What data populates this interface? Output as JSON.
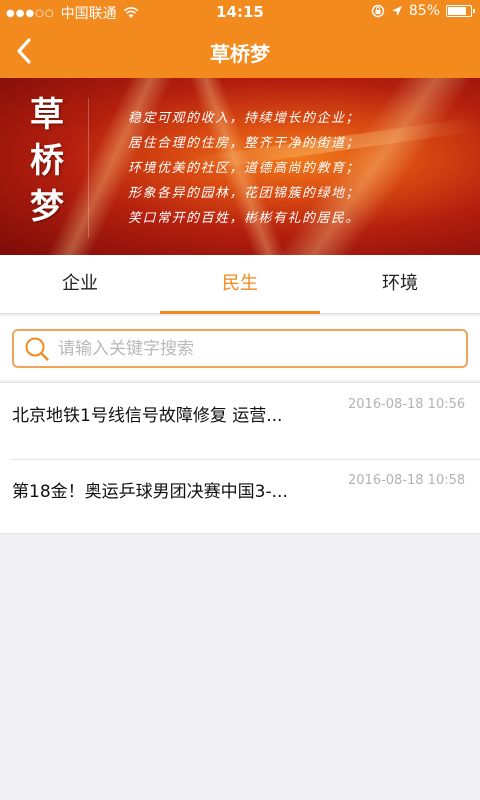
{
  "status_bar": {
    "signal": "●●●○○",
    "carrier": "中国联通",
    "time": "14:15",
    "battery_percent": "85%",
    "battery_level": 0.85
  },
  "nav": {
    "title": "草桥梦",
    "back_icon": "chevron-left-icon"
  },
  "banner": {
    "title_chars": [
      "草",
      "桥",
      "梦"
    ],
    "poem_lines": [
      "稳定可观的收入，持续增长的企业；",
      "居住合理的住房，整齐干净的街道；",
      "环境优美的社区，道德高尚的教育；",
      "形象各异的园林，花团锦簇的绿地；",
      "笑口常开的百姓，彬彬有礼的居民。"
    ]
  },
  "tabs": [
    {
      "label": "企业",
      "active": false
    },
    {
      "label": "民生",
      "active": true
    },
    {
      "label": "环境",
      "active": false
    }
  ],
  "search": {
    "placeholder": "请输入关键字搜索",
    "value": ""
  },
  "news": [
    {
      "title": "北京地铁1号线信号故障修复 运营...",
      "date": "2016-08-18 10:56"
    },
    {
      "title": "第18金！奥运乒球男团决赛中国3-...",
      "date": "2016-08-18 10:58"
    }
  ],
  "colors": {
    "accent": "#f28a1e",
    "background": "#efeff4"
  }
}
